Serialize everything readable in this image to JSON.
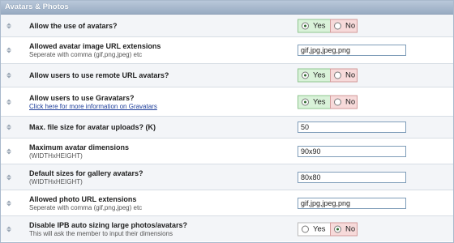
{
  "section": {
    "title": "Avatars & Photos"
  },
  "rows": [
    {
      "title": "Allow the use of avatars?",
      "yes": "Yes",
      "no": "No",
      "selected": "yes"
    },
    {
      "title": "Allowed avatar image URL extensions",
      "desc": "Seperate with comma (gif,png,jpeg) etc",
      "value": "gif,jpg,jpeg,png"
    },
    {
      "title": "Allow users to use remote URL avatars?",
      "yes": "Yes",
      "no": "No",
      "selected": "yes"
    },
    {
      "title": "Allow users to use Gravatars?",
      "desc": "Click here for more information on Gravatars",
      "yes": "Yes",
      "no": "No",
      "selected": "yes"
    },
    {
      "title": "Max. file size for avatar uploads? (K)",
      "value": "50"
    },
    {
      "title": "Maximum avatar dimensions",
      "desc": "(WIDTHxHEIGHT)",
      "value": "90x90"
    },
    {
      "title": "Default sizes for gallery avatars?",
      "desc": "(WIDTHxHEIGHT)",
      "value": "80x80"
    },
    {
      "title": "Allowed photo URL extensions",
      "desc": "Seperate with comma (gif,png,jpeg) etc",
      "value": "gif,jpg,jpeg,png"
    },
    {
      "title": "Disable IPB auto sizing large photos/avatars?",
      "desc": "This will ask the member to input their dimensions",
      "yes": "Yes",
      "no": "No",
      "selected": "no"
    }
  ]
}
